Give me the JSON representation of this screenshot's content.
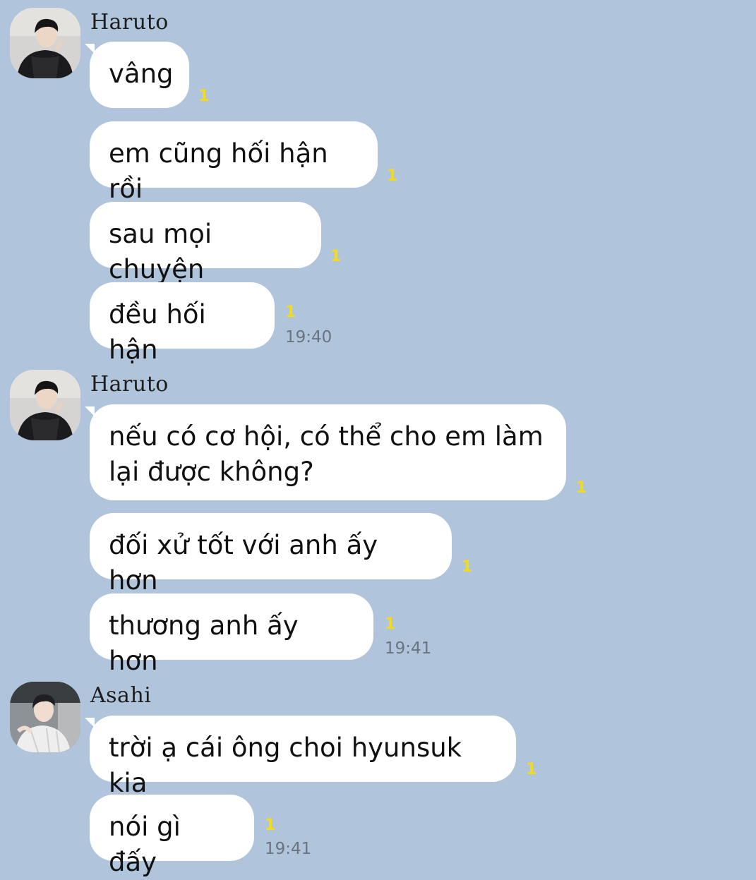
{
  "colors": {
    "background": "#b0c5db",
    "bubble": "#ffffff",
    "read_count": "#f2da1c",
    "timestamp": "#6a7480"
  },
  "groups": [
    {
      "sender": "Haruto",
      "avatar": "avatar-haruto",
      "messages": [
        {
          "text": "vâng",
          "read": "1"
        },
        {
          "text": "em cũng hối hận rồi",
          "read": "1"
        },
        {
          "text": "sau mọi chuyện",
          "read": "1"
        },
        {
          "text": "đều hối hận",
          "read": "1",
          "time": "19:40"
        }
      ]
    },
    {
      "sender": "Haruto",
      "avatar": "avatar-haruto",
      "messages": [
        {
          "text": "nếu có cơ hội, có thể cho em làm\nlại được không?",
          "read": "1"
        },
        {
          "text": "đối xử tốt với anh ấy hơn",
          "read": "1"
        },
        {
          "text": "thương anh ấy hơn",
          "read": "1",
          "time": "19:41"
        }
      ]
    },
    {
      "sender": "Asahi",
      "avatar": "avatar-asahi",
      "messages": [
        {
          "text": "trời ạ cái ông choi hyunsuk kia",
          "read": "1"
        },
        {
          "text": "nói gì đấy",
          "read": "1",
          "time": "19:41"
        }
      ]
    }
  ]
}
